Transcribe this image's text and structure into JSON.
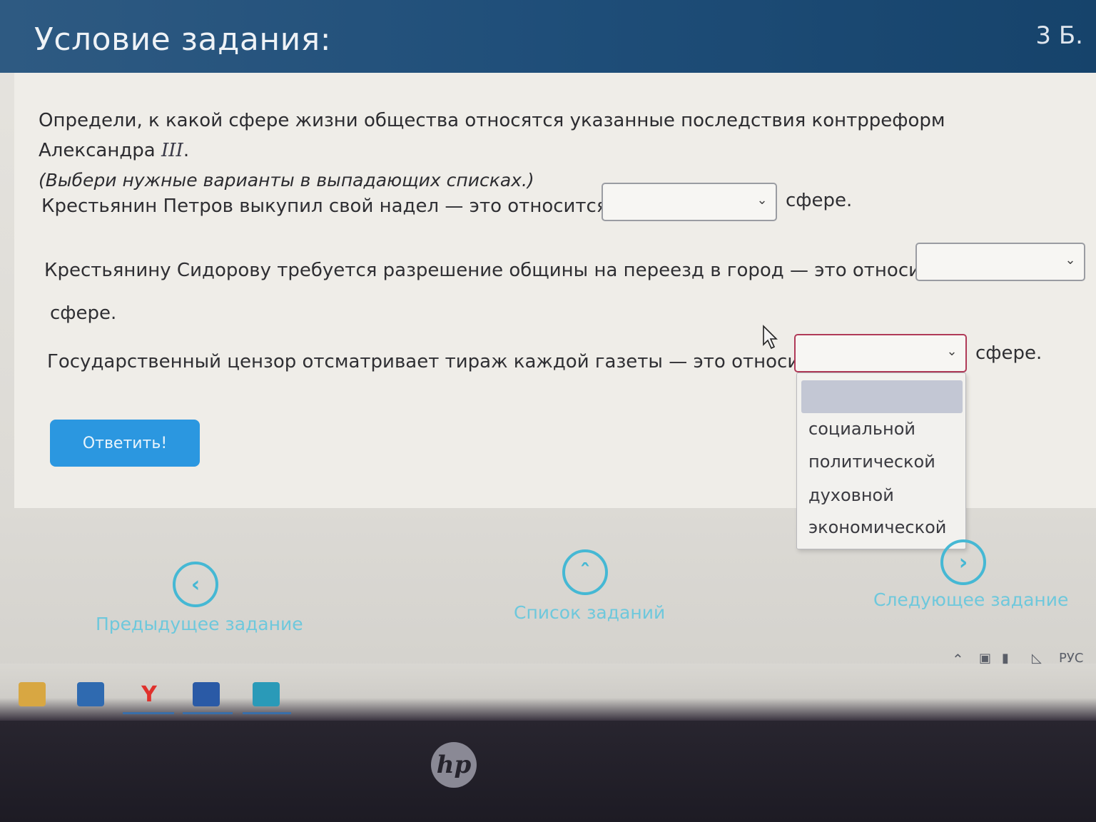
{
  "header": {
    "title": "Условие задания:",
    "points": "3 Б."
  },
  "instruction": {
    "main": "Определи, к какой сфере жизни общества относятся указанные последствия контрреформ Александра ",
    "roman": "III",
    "period": ".",
    "hint": "(Выбери нужные варианты в выпадающих списках.)"
  },
  "questions": [
    {
      "text": "Крестьянин Петров выкупил свой надел — это относится к",
      "after": "сфере.",
      "selected": ""
    },
    {
      "text": "Крестьянину Сидорову требуется разрешение общины на переезд в город — это относится к",
      "after": "сфере.",
      "selected": ""
    },
    {
      "text": "Государственный цензор отсматривает тираж каждой газеты — это относится к",
      "after": "сфере.",
      "selected": ""
    }
  ],
  "dropdown": {
    "options": [
      "",
      "социальной",
      "политической",
      "духовной",
      "экономической"
    ],
    "highlighted_index": 0
  },
  "buttons": {
    "answer": "Ответить!"
  },
  "nav": {
    "prev": "Предыдущее задание",
    "list": "Список заданий",
    "next": "Следующее задание"
  },
  "tray": {
    "language": "РУС"
  },
  "icons": {
    "chevron": "chevron-down-icon",
    "prev": "chevron-left-icon",
    "list": "chevron-up-icon",
    "next": "chevron-right-icon",
    "logo": "hp-logo"
  },
  "colors": {
    "header": "#1f4e79",
    "accent": "#2b97e0",
    "nav": "#45b8d4"
  }
}
